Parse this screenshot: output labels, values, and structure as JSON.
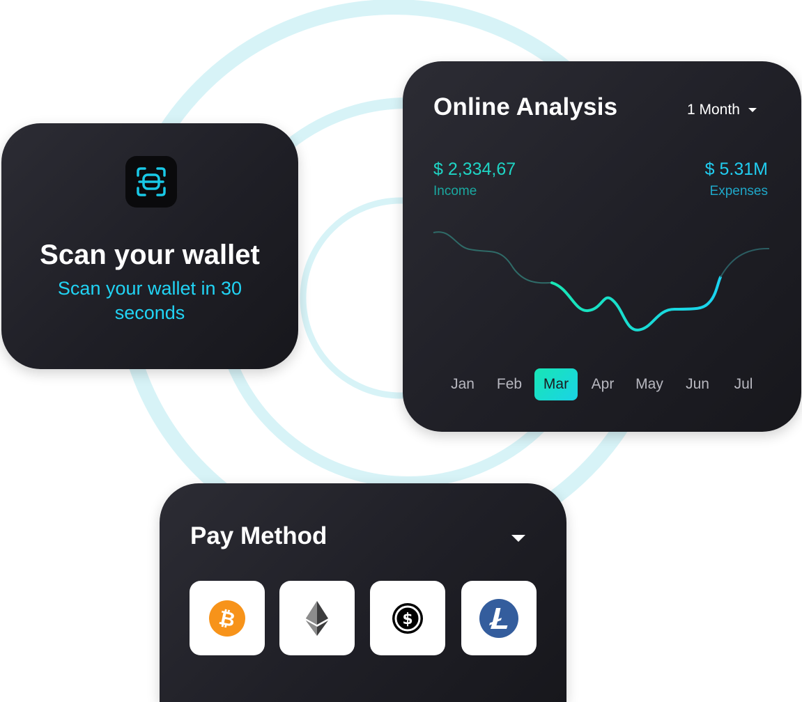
{
  "colors": {
    "card_bg": "#1f1f26",
    "accent_teal": "#1fd4c4",
    "accent_cyan": "#21cdf0",
    "ring": "#d7f3f7",
    "bitcoin": "#f7931a",
    "litecoin": "#345d9d"
  },
  "scan": {
    "icon": "scan-icon",
    "title": "Scan your wallet",
    "subtitle": "Scan your wallet in 30 seconds"
  },
  "analysis": {
    "title": "Online Analysis",
    "period": "1 Month",
    "income": {
      "value": "$ 2,334,67",
      "label": "Income"
    },
    "expenses": {
      "value": "$ 5.31M",
      "label": "Expenses"
    },
    "months": [
      "Jan",
      "Feb",
      "Mar",
      "Apr",
      "May",
      "Jun",
      "Jul"
    ],
    "active_month": "Mar"
  },
  "pay": {
    "title": "Pay Method",
    "methods": [
      {
        "name": "Bitcoin",
        "icon": "bitcoin-icon"
      },
      {
        "name": "Ethereum",
        "icon": "ethereum-icon"
      },
      {
        "name": "Dollar coin",
        "icon": "dollar-coin-icon"
      },
      {
        "name": "Litecoin",
        "icon": "litecoin-icon"
      }
    ]
  }
}
